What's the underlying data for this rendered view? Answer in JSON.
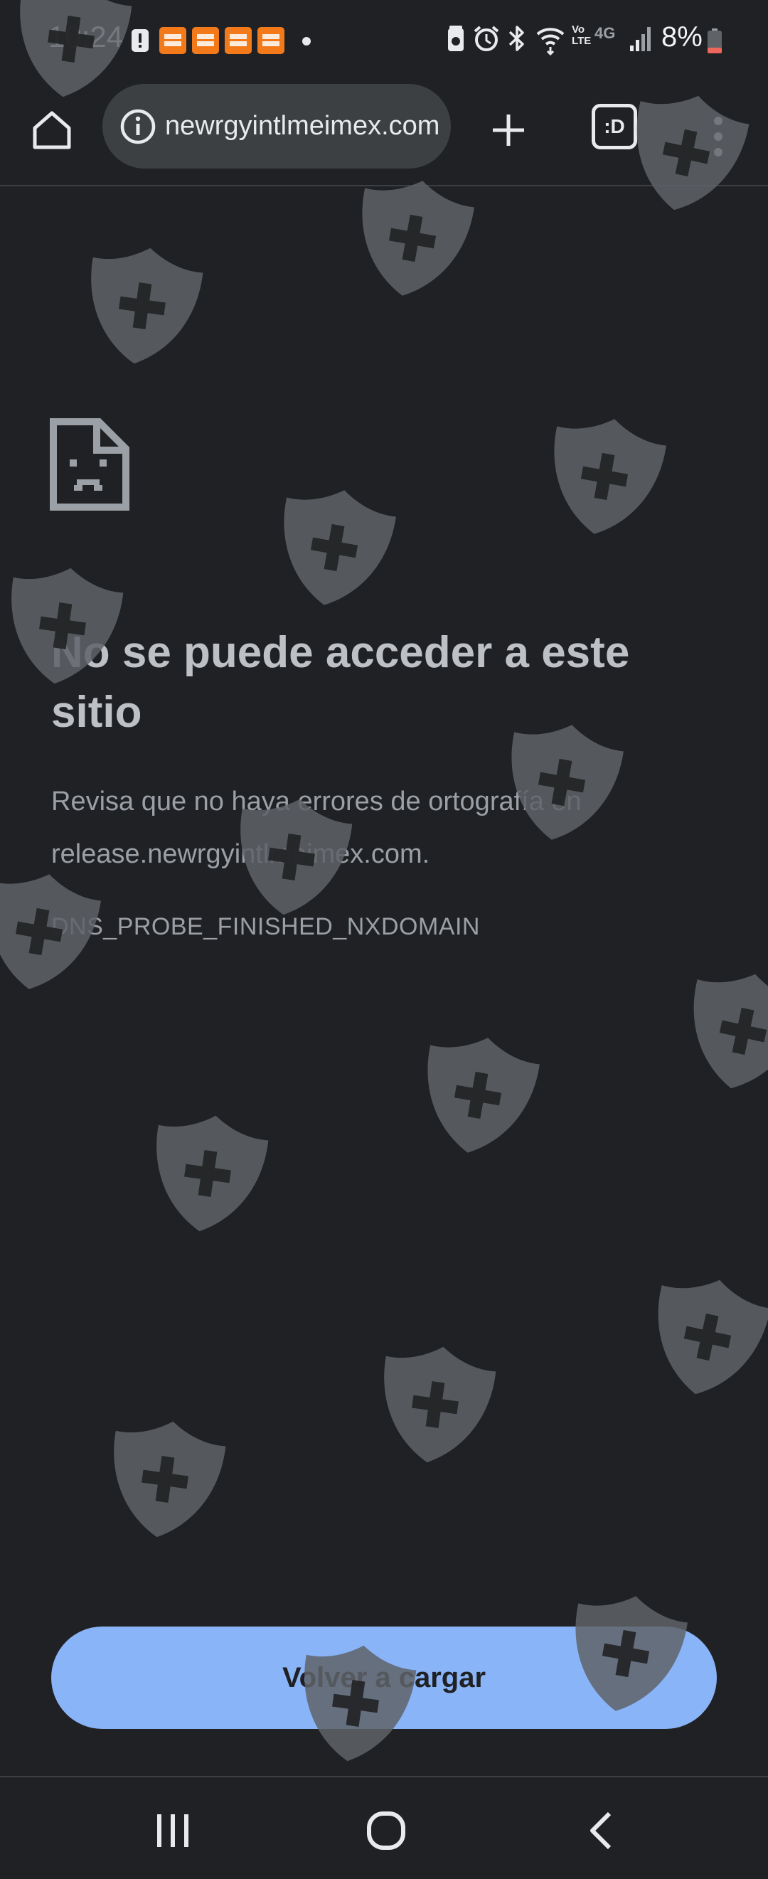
{
  "status_bar": {
    "time": "10:24",
    "notification_icons": [
      "alert-icon",
      "temu-icon",
      "temu-icon",
      "temu-icon",
      "temu-icon"
    ],
    "system_icons": [
      "battery-saver-icon",
      "alarm-icon",
      "bluetooth-icon",
      "wifi-icon",
      "volte-icon",
      "4g-icon",
      "signal-icon"
    ],
    "network": "4G",
    "battery_percent": "8%"
  },
  "toolbar": {
    "url": "newrgyintlmeimex.com",
    "tab_count_label": ":D"
  },
  "error": {
    "title": "No se puede acceder a este sitio",
    "body": "Revisa que no haya errores de ortografía en release.newrgyintlmeimex.com.",
    "code": "DNS_PROBE_FINISHED_NXDOMAIN",
    "reload_label": "Volver a cargar"
  },
  "colors": {
    "background": "#202124",
    "accent_button": "#8ab4f8",
    "text_primary": "#bdc1c6",
    "text_secondary": "#9aa0a6",
    "battery_low": "#ee675c",
    "temu_orange": "#f27a1a"
  }
}
